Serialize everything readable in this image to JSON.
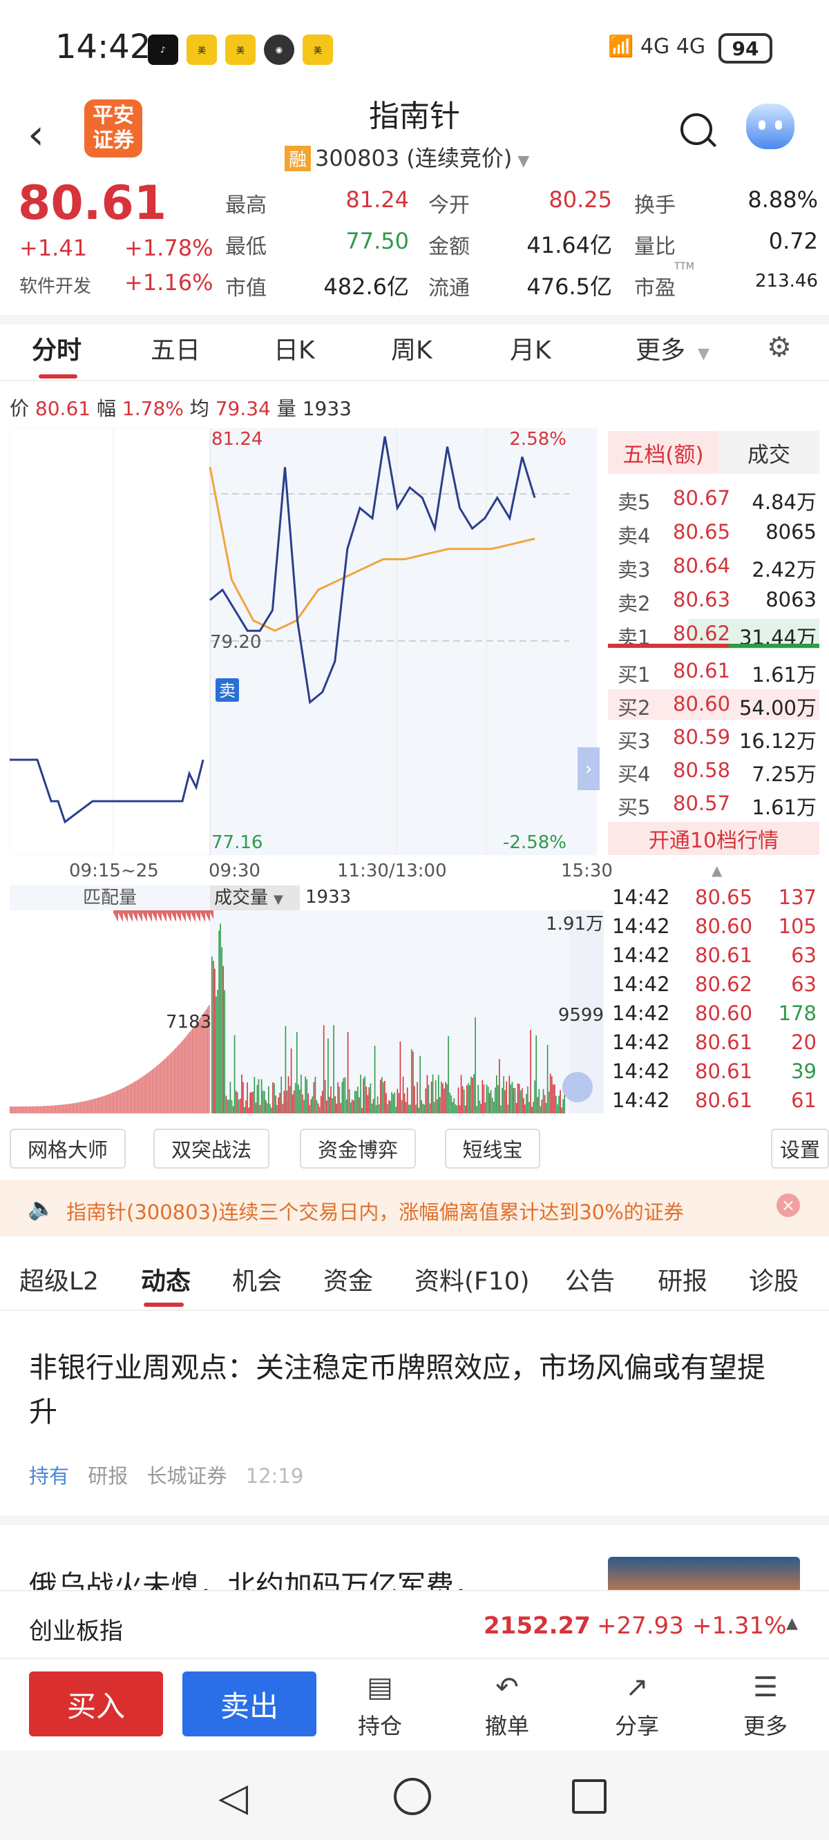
{
  "status_bar": {
    "time": "14:42",
    "network": "4G 4G",
    "battery": "94"
  },
  "header": {
    "back_icon": "chevron-left-icon",
    "broker_logo": "平安\n证券",
    "stock_name": "指南针",
    "margin_badge": "融",
    "stock_code_status": "300803 (连续竞价)"
  },
  "quote": {
    "price": "80.61",
    "change": "+1.41",
    "change_pct": "+1.78%",
    "sector": "软件开发",
    "sector_pct": "+1.16%",
    "fields": [
      {
        "label": "最高",
        "value": "81.24",
        "color": "red"
      },
      {
        "label": "今开",
        "value": "80.25",
        "color": "red"
      },
      {
        "label": "换手",
        "value": "8.88%",
        "color": "dark"
      },
      {
        "label": "最低",
        "value": "77.50",
        "color": "green"
      },
      {
        "label": "金额",
        "value": "41.64亿",
        "color": "dark"
      },
      {
        "label": "量比",
        "value": "0.72",
        "color": "dark"
      },
      {
        "label": "市值",
        "value": "482.6亿",
        "color": "dark"
      },
      {
        "label": "流通",
        "value": "476.5亿",
        "color": "dark"
      },
      {
        "label": "市盈",
        "value": "213.46",
        "color": "dark"
      }
    ],
    "pe_suffix": "TTM"
  },
  "chart_tabs": [
    "分时",
    "五日",
    "日K",
    "周K",
    "月K",
    "更多"
  ],
  "info_line": {
    "price_label": "价",
    "price": "80.61",
    "range_label": "幅",
    "range": "1.78%",
    "avg_label": "均",
    "avg": "79.34",
    "vol_label": "量",
    "vol": "1933"
  },
  "chart_labels": {
    "high": "81.24",
    "low": "77.16",
    "mid": "79.20",
    "high_pct": "2.58%",
    "low_pct": "-2.58%",
    "x_ticks": [
      "09:15~25",
      "09:30",
      "11:30/13:00",
      "15:30"
    ],
    "sell_marker": "卖",
    "vol_left_label": "匹配量",
    "vol_sel_label": "成交量",
    "vol_value": "1933",
    "vol_max": "1.91万",
    "vol_mid": "9599",
    "vol_pre": "7183"
  },
  "chart_data": {
    "type": "line",
    "title": "",
    "xlabel": "",
    "ylabel": "",
    "ylim": [
      77.16,
      81.24
    ],
    "x": [
      "09:15~25",
      "09:30",
      "11:30/13:00",
      "15:30"
    ],
    "series": [
      {
        "name": "",
        "values": [
          79.6,
          79.7,
          79.5,
          79.3,
          79.3,
          79.5,
          80.9,
          79.4,
          78.6,
          78.7,
          79.0,
          80.1,
          80.5,
          80.4,
          81.2,
          80.5,
          80.7,
          80.6,
          80.3,
          81.1,
          80.5,
          80.3,
          80.4,
          80.6,
          80.4,
          81.0,
          80.6
        ]
      },
      {
        "name": "",
        "values": [
          80.9,
          79.8,
          79.4,
          79.3,
          79.4,
          79.7,
          79.8,
          79.9,
          80.0,
          80.0,
          80.05,
          80.1,
          80.1,
          80.1,
          80.15,
          80.2
        ]
      }
    ]
  },
  "order_book": {
    "tabs": [
      "五档(额)",
      "成交"
    ],
    "asks": [
      {
        "label": "卖5",
        "price": "80.67",
        "vol": "4.84万"
      },
      {
        "label": "卖4",
        "price": "80.65",
        "vol": "8065"
      },
      {
        "label": "卖3",
        "price": "80.64",
        "vol": "2.42万"
      },
      {
        "label": "卖2",
        "price": "80.63",
        "vol": "8063"
      },
      {
        "label": "卖1",
        "price": "80.62",
        "vol": "31.44万"
      }
    ],
    "bids": [
      {
        "label": "买1",
        "price": "80.61",
        "vol": "1.61万"
      },
      {
        "label": "买2",
        "price": "80.60",
        "vol": "54.00万"
      },
      {
        "label": "买3",
        "price": "80.59",
        "vol": "16.12万"
      },
      {
        "label": "买4",
        "price": "80.58",
        "vol": "7.25万"
      },
      {
        "label": "买5",
        "price": "80.57",
        "vol": "1.61万"
      }
    ],
    "upgrade": "开通10档行情"
  },
  "trades": [
    {
      "time": "14:42",
      "price": "80.65",
      "vol": "137",
      "dir": "up"
    },
    {
      "time": "14:42",
      "price": "80.60",
      "vol": "105",
      "dir": "up"
    },
    {
      "time": "14:42",
      "price": "80.61",
      "vol": "63",
      "dir": "up"
    },
    {
      "time": "14:42",
      "price": "80.62",
      "vol": "63",
      "dir": "up"
    },
    {
      "time": "14:42",
      "price": "80.60",
      "vol": "178",
      "dir": "down"
    },
    {
      "time": "14:42",
      "price": "80.61",
      "vol": "20",
      "dir": "up"
    },
    {
      "time": "14:42",
      "price": "80.61",
      "vol": "39",
      "dir": "down"
    },
    {
      "time": "14:42",
      "price": "80.61",
      "vol": "61",
      "dir": "up"
    }
  ],
  "feature_buttons": [
    "网格大师",
    "双突战法",
    "资金博弈",
    "短线宝",
    "设置"
  ],
  "notice": "指南针(300803)连续三个交易日内，涨幅偏离值累计达到30%的证券",
  "sub_tabs": [
    "超级L2",
    "动态",
    "机会",
    "资金",
    "资料(F10)",
    "公告",
    "研报",
    "诊股"
  ],
  "news": [
    {
      "title": "非银行业周观点：关注稳定币牌照效应，市场风偏或有望提升",
      "rating": "持有",
      "type": "研报",
      "source": "长城证券",
      "time": "12:19"
    },
    {
      "title": "俄乌战火未熄，北约加码万亿军费，"
    }
  ],
  "index_bar": {
    "name": "创业板指",
    "value": "2152.27",
    "change": "+27.93",
    "pct": "+1.31%"
  },
  "bottom_nav": {
    "buy": "买入",
    "sell": "卖出",
    "items": [
      "持仓",
      "撤单",
      "分享",
      "更多"
    ]
  }
}
